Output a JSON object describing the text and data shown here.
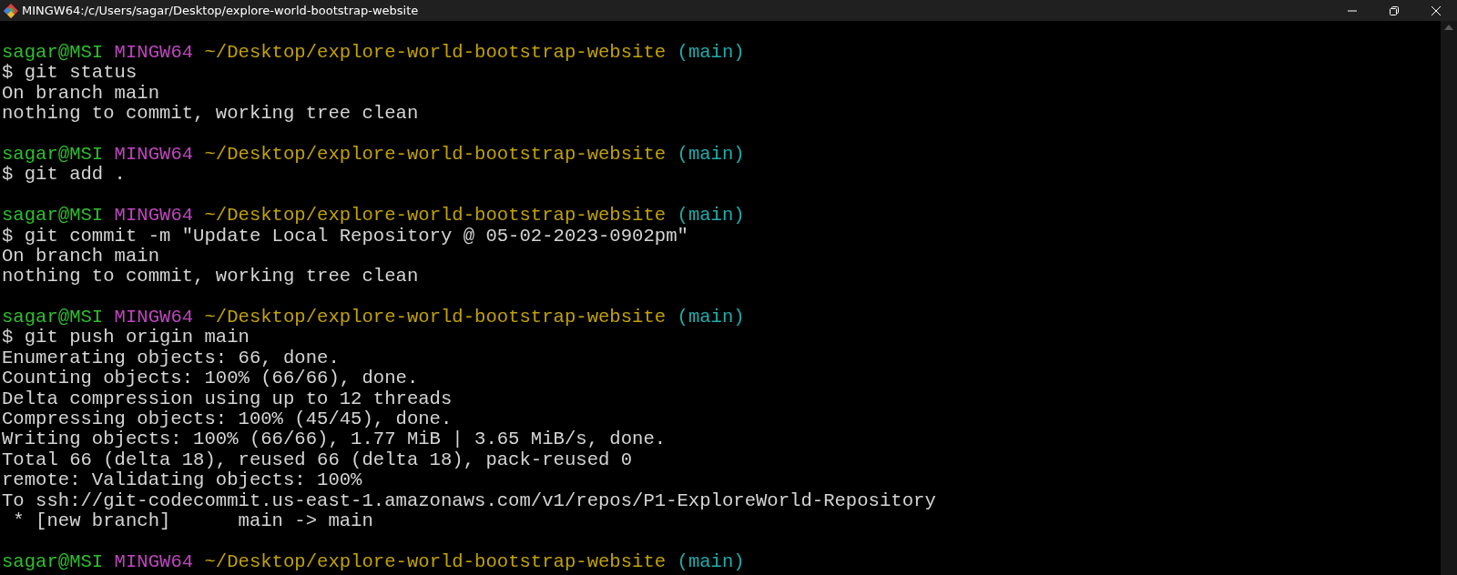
{
  "window": {
    "title": "MINGW64:/c/Users/sagar/Desktop/explore-world-bootstrap-website"
  },
  "lines": [
    {
      "kind": "text",
      "segments": [
        {
          "kind": "user",
          "text": "sagar@MSI"
        },
        {
          "kind": "system",
          "text": "MINGW64"
        },
        {
          "kind": "path",
          "text": "~/Desktop/explore-world-bootstrap-website"
        },
        {
          "kind": "branch",
          "text": "(main)"
        }
      ]
    },
    {
      "kind": "text",
      "segments": [
        {
          "kind": "plain",
          "text": "$ git status"
        }
      ]
    },
    {
      "kind": "text",
      "segments": [
        {
          "kind": "plain",
          "text": "On branch main"
        }
      ]
    },
    {
      "kind": "text",
      "segments": [
        {
          "kind": "plain",
          "text": "nothing to commit, working tree clean"
        }
      ]
    },
    {
      "kind": "blank"
    },
    {
      "kind": "text",
      "segments": [
        {
          "kind": "user",
          "text": "sagar@MSI"
        },
        {
          "kind": "system",
          "text": "MINGW64"
        },
        {
          "kind": "path",
          "text": "~/Desktop/explore-world-bootstrap-website"
        },
        {
          "kind": "branch",
          "text": "(main)"
        }
      ]
    },
    {
      "kind": "text",
      "segments": [
        {
          "kind": "plain",
          "text": "$ git add ."
        }
      ]
    },
    {
      "kind": "blank"
    },
    {
      "kind": "text",
      "segments": [
        {
          "kind": "user",
          "text": "sagar@MSI"
        },
        {
          "kind": "system",
          "text": "MINGW64"
        },
        {
          "kind": "path",
          "text": "~/Desktop/explore-world-bootstrap-website"
        },
        {
          "kind": "branch",
          "text": "(main)"
        }
      ]
    },
    {
      "kind": "text",
      "segments": [
        {
          "kind": "plain",
          "text": "$ git commit -m \"Update Local Repository @ 05-02-2023-0902pm\""
        }
      ]
    },
    {
      "kind": "text",
      "segments": [
        {
          "kind": "plain",
          "text": "On branch main"
        }
      ]
    },
    {
      "kind": "text",
      "segments": [
        {
          "kind": "plain",
          "text": "nothing to commit, working tree clean"
        }
      ]
    },
    {
      "kind": "blank"
    },
    {
      "kind": "text",
      "segments": [
        {
          "kind": "user",
          "text": "sagar@MSI"
        },
        {
          "kind": "system",
          "text": "MINGW64"
        },
        {
          "kind": "path",
          "text": "~/Desktop/explore-world-bootstrap-website"
        },
        {
          "kind": "branch",
          "text": "(main)"
        }
      ]
    },
    {
      "kind": "text",
      "segments": [
        {
          "kind": "plain",
          "text": "$ git push origin main"
        }
      ]
    },
    {
      "kind": "text",
      "segments": [
        {
          "kind": "plain",
          "text": "Enumerating objects: 66, done."
        }
      ]
    },
    {
      "kind": "text",
      "segments": [
        {
          "kind": "plain",
          "text": "Counting objects: 100% (66/66), done."
        }
      ]
    },
    {
      "kind": "text",
      "segments": [
        {
          "kind": "plain",
          "text": "Delta compression using up to 12 threads"
        }
      ]
    },
    {
      "kind": "text",
      "segments": [
        {
          "kind": "plain",
          "text": "Compressing objects: 100% (45/45), done."
        }
      ]
    },
    {
      "kind": "text",
      "segments": [
        {
          "kind": "plain",
          "text": "Writing objects: 100% (66/66), 1.77 MiB | 3.65 MiB/s, done."
        }
      ]
    },
    {
      "kind": "text",
      "segments": [
        {
          "kind": "plain",
          "text": "Total 66 (delta 18), reused 66 (delta 18), pack-reused 0"
        }
      ]
    },
    {
      "kind": "text",
      "segments": [
        {
          "kind": "plain",
          "text": "remote: Validating objects: 100%"
        }
      ]
    },
    {
      "kind": "text",
      "segments": [
        {
          "kind": "plain",
          "text": "To ssh://git-codecommit.us-east-1.amazonaws.com/v1/repos/P1-ExploreWorld-Repository"
        }
      ]
    },
    {
      "kind": "text",
      "segments": [
        {
          "kind": "plain",
          "text": " * [new branch]      main -> main"
        }
      ]
    },
    {
      "kind": "blank"
    },
    {
      "kind": "text",
      "segments": [
        {
          "kind": "user",
          "text": "sagar@MSI"
        },
        {
          "kind": "system",
          "text": "MINGW64"
        },
        {
          "kind": "path",
          "text": "~/Desktop/explore-world-bootstrap-website"
        },
        {
          "kind": "branch",
          "text": "(main)"
        }
      ]
    }
  ]
}
